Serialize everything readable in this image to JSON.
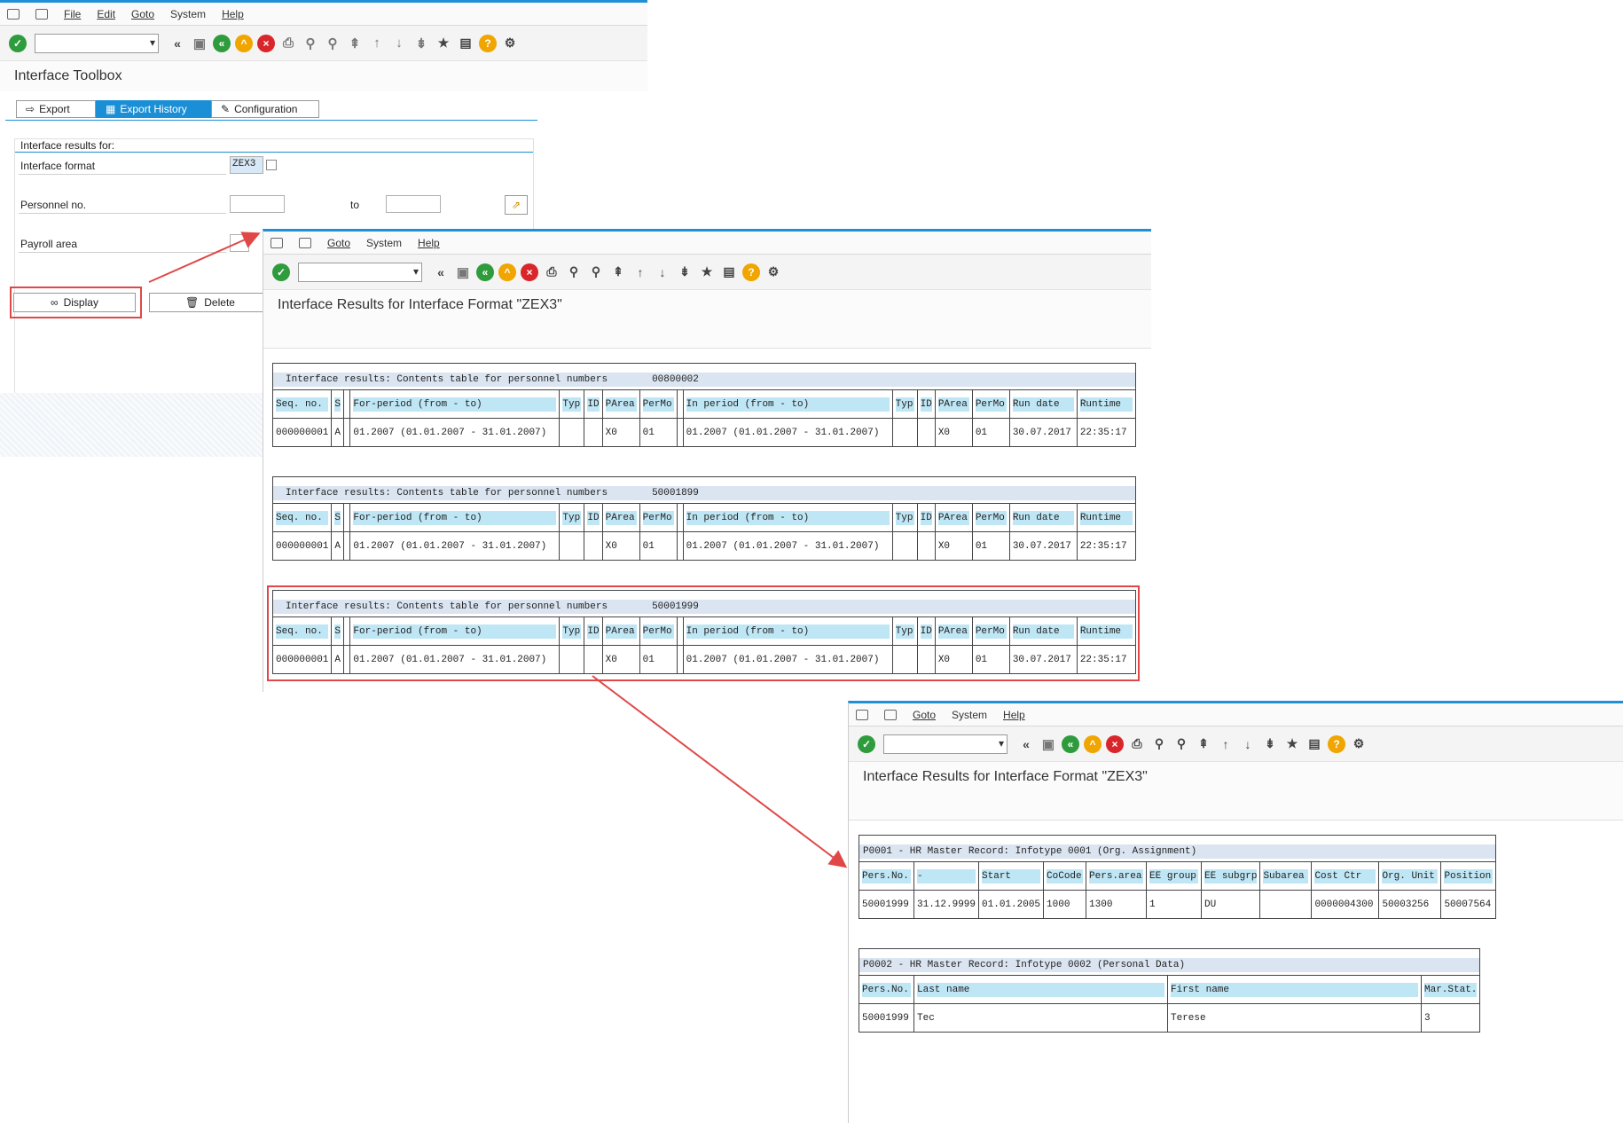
{
  "menu1": [
    "File",
    "Edit",
    "Goto",
    "System",
    "Help"
  ],
  "menu2": [
    "Goto",
    "System",
    "Help"
  ],
  "win1": {
    "title": "Interface Toolbox",
    "tabs": [
      "Export",
      "Export History",
      "Configuration"
    ],
    "section": "Interface results for:",
    "format_label": "Interface format",
    "format_value": "ZEX3",
    "persno_label": "Personnel no.",
    "to_label": "to",
    "payroll_label": "Payroll area",
    "display_btn": "Display",
    "delete_btn": "Delete"
  },
  "win2": {
    "title": "Interface Results for Interface Format \"ZEX3\"",
    "caption_prefix": "Interface results: Contents table for personnel numbers",
    "headers": [
      "Seq. no.",
      "S",
      "",
      "For-period  (from - to)",
      "Typ",
      "ID",
      "PArea",
      "PerMo",
      "",
      "In period  (from - to)",
      "Typ",
      "ID",
      "PArea",
      "PerMo",
      "Run date",
      "Runtime"
    ],
    "tables": [
      {
        "persno": "00800002",
        "row": [
          "000000001",
          "A",
          "",
          "01.2007  (01.01.2007 - 31.01.2007)",
          "",
          "",
          "X0",
          "01",
          "",
          "01.2007  (01.01.2007 - 31.01.2007)",
          "",
          "",
          "X0",
          "01",
          "30.07.2017",
          "22:35:17"
        ]
      },
      {
        "persno": "50001899",
        "row": [
          "000000001",
          "A",
          "",
          "01.2007  (01.01.2007 - 31.01.2007)",
          "",
          "",
          "X0",
          "01",
          "",
          "01.2007  (01.01.2007 - 31.01.2007)",
          "",
          "",
          "X0",
          "01",
          "30.07.2017",
          "22:35:17"
        ]
      },
      {
        "persno": "50001999",
        "row": [
          "000000001",
          "A",
          "",
          "01.2007  (01.01.2007 - 31.01.2007)",
          "",
          "",
          "X0",
          "01",
          "",
          "01.2007  (01.01.2007 - 31.01.2007)",
          "",
          "",
          "X0",
          "01",
          "30.07.2017",
          "22:35:17"
        ]
      }
    ]
  },
  "win3": {
    "title": "Interface Results for Interface Format \"ZEX3\"",
    "p0001": {
      "caption": "P0001 - HR Master Record: Infotype 0001 (Org. Assignment)",
      "headers": [
        "Pers.No.",
        "-",
        "Start",
        "CoCode",
        "Pers.area",
        "EE group",
        "EE subgrp",
        "Subarea",
        "Cost Ctr",
        "Org. Unit",
        "Position"
      ],
      "row": [
        "50001999",
        "31.12.9999",
        "01.01.2005",
        "1000",
        "1300",
        "1",
        "DU",
        "",
        "0000004300",
        "50003256",
        "50007564"
      ]
    },
    "p0002": {
      "caption": "P0002 - HR Master Record: Infotype 0002 (Personal Data)",
      "headers": [
        "Pers.No.",
        "Last name",
        "First name",
        "Mar.Stat."
      ],
      "row": [
        "50001999",
        "Tec",
        "Terese",
        "3"
      ]
    }
  },
  "icons": [
    "ok-icon",
    "back-icon",
    "save-icon",
    "green-back-icon",
    "up-icon",
    "cancel-icon",
    "print-icon",
    "find-icon",
    "find-next-icon",
    "first-page-icon",
    "prev-page-icon",
    "next-page-icon",
    "last-page-icon",
    "new-session-icon",
    "shortcut-icon",
    "help-icon",
    "settings-icon"
  ],
  "colors": {
    "accent": "#1a8fd6",
    "highlight_box": "#e04848",
    "header_cell": "#bfe6f5",
    "caption_bar": "#dbe5f1"
  }
}
